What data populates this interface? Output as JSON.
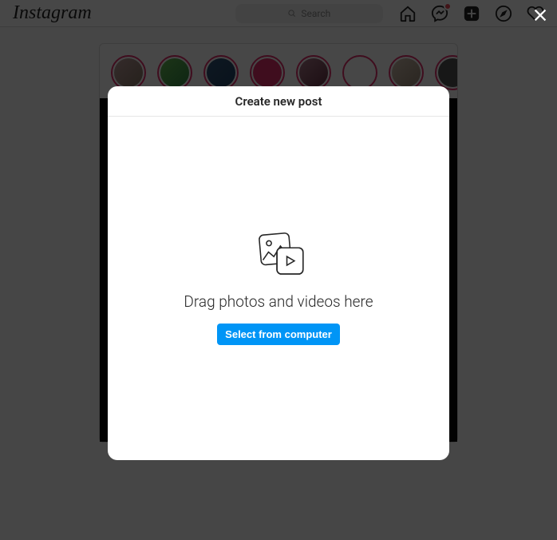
{
  "brand": "Instagram",
  "search": {
    "placeholder": "Search"
  },
  "modal": {
    "title": "Create new post",
    "drop_text": "Drag photos and videos here",
    "select_button": "Select from computer"
  }
}
